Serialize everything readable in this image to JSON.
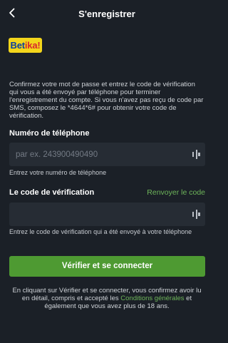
{
  "header": {
    "title": "S'enregistrer",
    "back_icon": "chevron-left-icon"
  },
  "logo": {
    "text_main": "Bet",
    "text_accent": "ika!",
    "colors": {
      "bg": "#f3d51b",
      "text": "#0b3e9e",
      "accent": "#d7262e"
    }
  },
  "intro": {
    "text": "Confirmez votre mot de passe et entrez le code de vérification qui vous a été envoyé par téléphone pour terminer l'enregistrement du compte. Si vous n'avez pas reçu de code par SMS, composez le *4644*6# pour obtenir votre code de vérification."
  },
  "phone": {
    "label": "Numéro de téléphone",
    "value": "",
    "placeholder": "par ex. 243900490490",
    "hint": "Entrez votre numéro de téléphone",
    "icon": "password-dots-icon"
  },
  "code": {
    "label": "Le code de vérification",
    "resend_label": "Renvoyer le code",
    "value": "",
    "placeholder": "",
    "hint": "Entrez le code de vérification qui a été envoyé à votre téléphone",
    "icon": "password-dots-icon"
  },
  "submit": {
    "label": "Vérifier et se connecter"
  },
  "terms": {
    "before": "En cliquant sur Vérifier et se connecter, vous confirmez avoir lu en détail, compris et accepté les ",
    "link": "Conditions générales",
    "after": " et également que vous avez plus de 18 ans."
  },
  "colors": {
    "background": "#1b2027",
    "field": "#262c34",
    "accent": "#4e9a32",
    "link": "#6eb55a"
  }
}
